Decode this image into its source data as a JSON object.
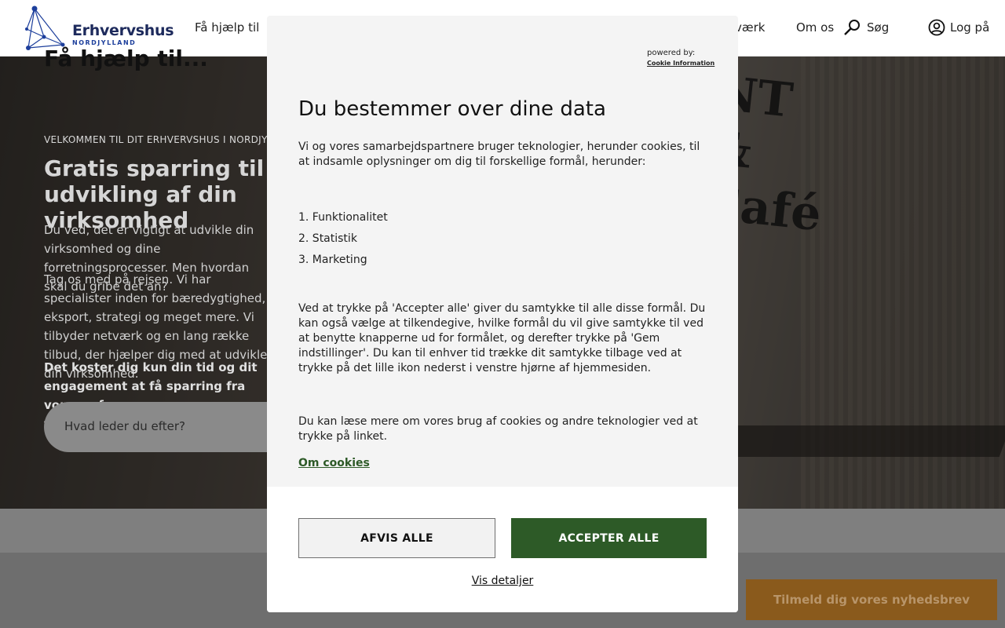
{
  "colors": {
    "brand_navy": "#1d2a5c",
    "accept_green": "#2d5a27",
    "newsletter_orange": "#8a5a1c",
    "modal_bg": "#f4f4f4"
  },
  "header": {
    "logo": {
      "name": "Erhvervshus",
      "sub": "NORDJYLLAND",
      "icon": "network-logo-icon"
    },
    "nav": {
      "get_help": "Få hjælp til",
      "network": "værk",
      "about": "Om os",
      "search": "Søg",
      "search_icon": "search-icon",
      "login": "Log på",
      "login_icon": "user-circle-icon"
    }
  },
  "hero": {
    "kicker": "VELKOMMEN TIL DIT ERHVERVSHUS I NORDJYLLAND",
    "title": "Gratis sparring til udvikling af din virksomhed",
    "p1": "Du ved, det er vigtigt at udvikle din virksomhed og dine forretningsprocesser. Men hvordan skal du gribe det an?",
    "p2": "Tag os med på rejsen. Vi har specialister inden for bæredygtighed, eksport, strategi og meget mere. Vi tilbyder netværk og en lang række tilbud, der hjælper dig med at udvikle din virksomhed.",
    "p3": "Det koster dig kun din tid og dit engagement at få sparring fra vores erfarne forretningsudviklere.",
    "search_placeholder": "Hvad leder du efter?",
    "sign_text": "NT & Café"
  },
  "lower": {
    "title": "Få hjælp til...",
    "newsletter_button": "Tilmeld dig vores nyhedsbrev"
  },
  "modal": {
    "powered_by": "powered by:",
    "powered_link": "Cookie Information",
    "title": "Du bestemmer over dine data",
    "intro": "Vi og vores samarbejdspartnere bruger teknologier, herunder cookies, til at indsamle oplysninger om dig til forskellige formål, herunder:",
    "purposes": [
      "1. Funktionalitet",
      "2. Statistik",
      "3. Marketing"
    ],
    "consent_text": "Ved at trykke på 'Accepter alle' giver du samtykke til alle disse formål. Du kan også vælge at tilkendegive, hvilke formål du vil give samtykke til ved at benytte knapperne ud for formålet, og derefter trykke på 'Gem indstillinger'. Du kan til enhver tid trække dit samtykke tilbage ved at trykke på det lille ikon nederst i venstre hjørne af hjemmesiden.",
    "more_text": "Du kan læse mere om vores brug af cookies og andre teknologier ved at trykke på linket.",
    "cookies_link": "Om cookies",
    "reject_button": "AFVIS ALLE",
    "accept_button": "ACCEPTER ALLE",
    "details_link": "Vis detaljer"
  }
}
